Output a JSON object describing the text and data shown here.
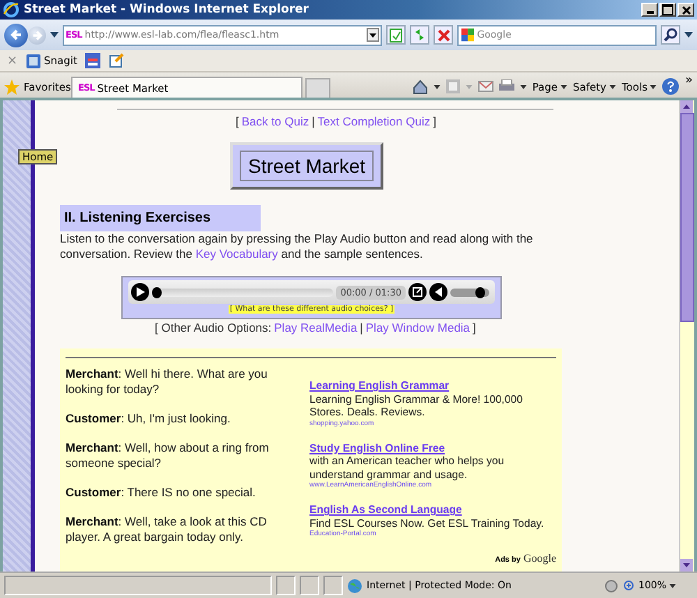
{
  "window": {
    "title": "Street Market - Windows Internet Explorer"
  },
  "address_bar": {
    "url": "http://www.esl-lab.com/flea/fleasc1.htm",
    "site_badge": "ESL"
  },
  "search": {
    "placeholder": "Google"
  },
  "links_bar": {
    "close": "×",
    "items": [
      "Snagit"
    ]
  },
  "favorites_bar": {
    "label": "Favorites",
    "tab": {
      "badge": "ESL",
      "title": "Street Market",
      "selected": true
    },
    "commands": [
      "Page",
      "Safety",
      "Tools"
    ],
    "overflow": "»"
  },
  "page": {
    "home_button": "Home",
    "nav": {
      "open": "[",
      "links": [
        "Back to Quiz",
        "Text Completion Quiz"
      ],
      "separator": "|",
      "close": "]"
    },
    "title": "Street Market",
    "section_heading": "II. Listening Exercises",
    "intro": "Listen to the conversation again by pressing the Play Audio button and read along with the conversation. Review the ",
    "intro_link": "Key Vocabulary",
    "intro_end": " and the sample sentences.",
    "player": {
      "time": "00:00 / 01:30",
      "progress": {
        "level": 0.0
      },
      "volume": {
        "level": 0.85
      },
      "help": "[ What are these different audio choices? ]"
    },
    "audio_options": {
      "label": "[ Other Audio Options: ",
      "links": [
        "Play RealMedia",
        "Play Window Media"
      ],
      "separator": "|",
      "close": "]"
    },
    "dialogue": [
      {
        "speaker": "Merchant",
        "line": ": Well hi there. What are you looking for today?"
      },
      {
        "speaker": "Customer",
        "line": ": Uh, I'm just looking."
      },
      {
        "speaker": "Merchant",
        "line": ": Well, how about a ring from someone special?"
      },
      {
        "speaker": "Customer",
        "line": ": There IS no one special."
      },
      {
        "speaker": "Merchant",
        "line": ": Well, take a look at this CD player. A great bargain today only."
      }
    ],
    "ads": [
      {
        "title": "Learning English Grammar",
        "text": "Learning English Grammar & More! 100,000 Stores. Deals. Reviews.",
        "url": "shopping.yahoo.com"
      },
      {
        "title": "Study English Online Free",
        "text": "with an American teacher who helps you understand grammar and usage.",
        "url": "www.LearnAmericanEnglishOnline.com"
      },
      {
        "title": "English As Second Language",
        "text": "Find ESL Courses Now. Get ESL Training Today.",
        "url": "Education-Portal.com"
      }
    ],
    "ads_by": "Ads by",
    "ads_brand": "Google"
  },
  "status_bar": {
    "zone": "Internet | Protected Mode: On",
    "zoom": "100%"
  }
}
